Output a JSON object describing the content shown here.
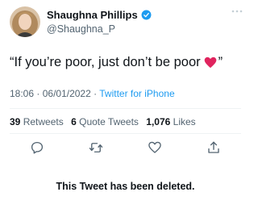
{
  "user": {
    "display_name": "Shaughna Phillips",
    "handle": "@Shaughna_P"
  },
  "tweet": {
    "text_before_emoji": "“If you’re poor, just don’t be poor",
    "text_after_emoji": "”"
  },
  "meta": {
    "time": "18:06",
    "separator1": "·",
    "date": "06/01/2022",
    "separator2": "·",
    "source": "Twitter for iPhone"
  },
  "stats": {
    "retweets_count": "39",
    "retweets_label": "Retweets",
    "quote_count": "6",
    "quote_label": "Quote Tweets",
    "likes_count": "1,076",
    "likes_label": "Likes"
  },
  "notice": "This Tweet has been deleted.",
  "colors": {
    "accent": "#1d9bf0",
    "text": "#0f1419",
    "secondary": "#536471",
    "heart": "#e0245e",
    "divider": "#eff3f4"
  }
}
